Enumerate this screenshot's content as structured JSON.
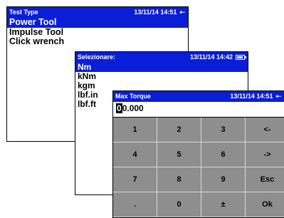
{
  "screen1": {
    "title": "Test Type",
    "timestamp": "13/11/14 14:51",
    "status_icon": "plug-icon",
    "items": [
      {
        "label": "Power Tool",
        "selected": true
      },
      {
        "label": "Impulse Tool",
        "selected": false
      },
      {
        "label": "Click wrench",
        "selected": false
      }
    ]
  },
  "screen2": {
    "title": "Selezionare:",
    "timestamp": "13/11/14 14:42",
    "status_icon": "battery-icon",
    "items": [
      {
        "label": "Nm",
        "selected": true
      },
      {
        "label": "kNm",
        "selected": false
      },
      {
        "label": "kgm",
        "selected": false
      },
      {
        "label": "lbf.in",
        "selected": false
      },
      {
        "label": "lbf.ft",
        "selected": false
      }
    ]
  },
  "screen3": {
    "title": "Max Torque",
    "timestamp": "13/11/14 14:51",
    "status_icon": "plug-icon",
    "input": {
      "cursor_char": "0",
      "rest": "0.000"
    },
    "keys": [
      "1",
      "2",
      "3",
      "<-",
      "4",
      "5",
      "6",
      "->",
      "7",
      "8",
      "9",
      "Esc",
      ".",
      "0",
      "±",
      "Ok"
    ]
  },
  "colors": {
    "titlebar": "#0a1ed8",
    "keypad": "#8e8e8e",
    "selection": "#0a1ed8"
  }
}
